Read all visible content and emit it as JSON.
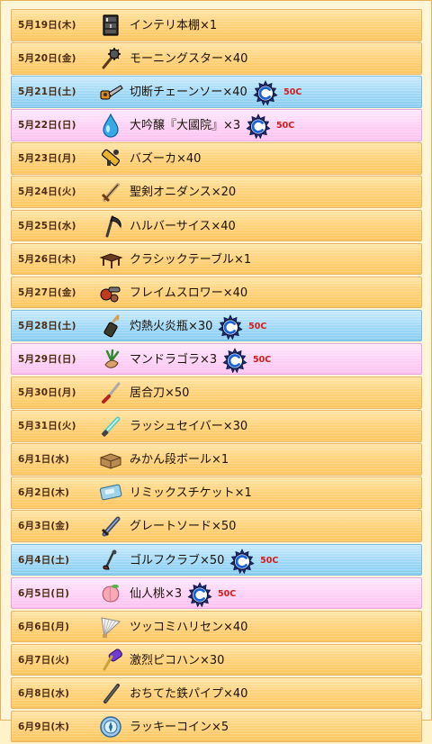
{
  "accent_colors": {
    "default_row": "#ffd37c",
    "saturday_row": "#9fd8f7",
    "sunday_row": "#ffd0f6",
    "price_text": "#d61b1b"
  },
  "rows": [
    {
      "date": "5月19日(木)",
      "item": "インテリ本棚×1",
      "icon": "bookshelf-icon",
      "style": "default"
    },
    {
      "date": "5月20日(金)",
      "item": "モーニングスター×40",
      "icon": "morning-star-icon",
      "style": "default"
    },
    {
      "date": "5月21日(土)",
      "item": "切断チェーンソー×40",
      "icon": "chainsaw-icon",
      "style": "blue",
      "price": "50C",
      "badge_icon": "c-coin-badge-icon"
    },
    {
      "date": "5月22日(日)",
      "item": "大吟醸『大國院』×3",
      "icon": "water-drop-icon",
      "style": "pink",
      "price": "50C",
      "badge_icon": "c-coin-badge-icon"
    },
    {
      "date": "5月23日(月)",
      "item": "バズーカ×40",
      "icon": "bazooka-icon",
      "style": "default"
    },
    {
      "date": "5月24日(火)",
      "item": "聖剣オニダンス×20",
      "icon": "sword-icon",
      "style": "default"
    },
    {
      "date": "5月25日(水)",
      "item": "ハルバーサイス×40",
      "icon": "scythe-icon",
      "style": "default"
    },
    {
      "date": "5月26日(木)",
      "item": "クラシックテーブル×1",
      "icon": "table-icon",
      "style": "default"
    },
    {
      "date": "5月27日(金)",
      "item": "フレイムスロワー×40",
      "icon": "flamethrower-icon",
      "style": "default"
    },
    {
      "date": "5月28日(土)",
      "item": "灼熱火炎瓶×30",
      "icon": "fire-bottle-icon",
      "style": "blue",
      "price": "50C",
      "badge_icon": "c-coin-badge-icon"
    },
    {
      "date": "5月29日(日)",
      "item": "マンドラゴラ×3",
      "icon": "mandrake-icon",
      "style": "pink",
      "price": "50C",
      "badge_icon": "c-coin-badge-icon"
    },
    {
      "date": "5月30日(月)",
      "item": "居合刀×50",
      "icon": "katana-icon",
      "style": "default"
    },
    {
      "date": "5月31日(火)",
      "item": "ラッシュセイバー×30",
      "icon": "saber-icon",
      "style": "default"
    },
    {
      "date": "6月1日(水)",
      "item": "みかん段ボール×1",
      "icon": "cardboard-box-icon",
      "style": "default"
    },
    {
      "date": "6月2日(木)",
      "item": "リミックスチケット×1",
      "icon": "ticket-icon",
      "style": "default"
    },
    {
      "date": "6月3日(金)",
      "item": "グレートソード×50",
      "icon": "great-sword-icon",
      "style": "default"
    },
    {
      "date": "6月4日(土)",
      "item": "ゴルフクラブ×50",
      "icon": "golf-club-icon",
      "style": "blue",
      "price": "50C",
      "badge_icon": "c-coin-badge-icon"
    },
    {
      "date": "6月5日(日)",
      "item": "仙人桃×3",
      "icon": "peach-icon",
      "style": "pink",
      "price": "50C",
      "badge_icon": "c-coin-badge-icon"
    },
    {
      "date": "6月6日(月)",
      "item": "ツッコミハリセン×40",
      "icon": "paper-fan-icon",
      "style": "default"
    },
    {
      "date": "6月7日(火)",
      "item": "激烈ピコハン×30",
      "icon": "toy-hammer-icon",
      "style": "default"
    },
    {
      "date": "6月8日(水)",
      "item": "おちてた鉄パイプ×40",
      "icon": "iron-pipe-icon",
      "style": "default"
    },
    {
      "date": "6月9日(木)",
      "item": "ラッキーコイン×5",
      "icon": "lucky-coin-icon",
      "style": "default"
    }
  ]
}
